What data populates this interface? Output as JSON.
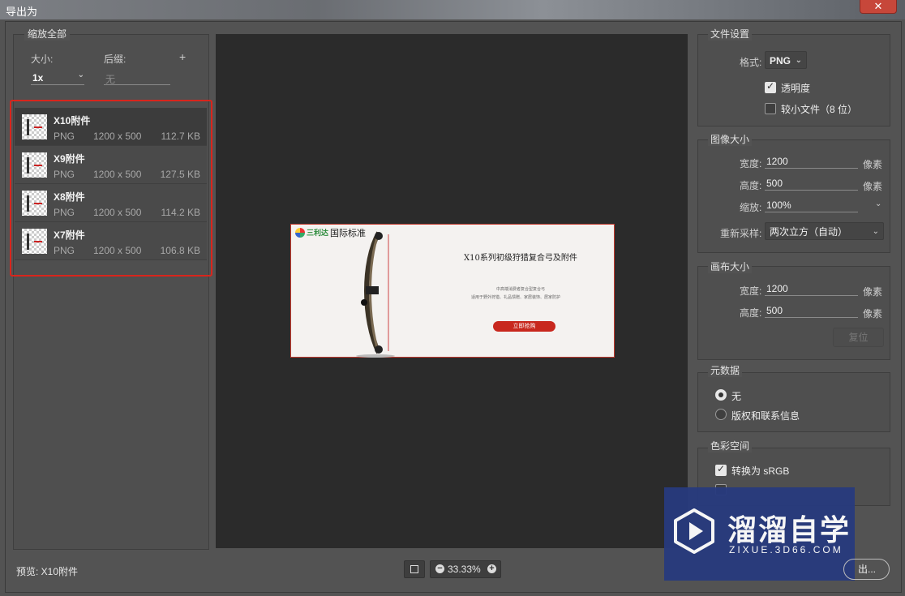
{
  "window": {
    "title": "导出为",
    "close_icon": "✕"
  },
  "left_panel": {
    "group_title": "缩放全部",
    "size_label": "大小:",
    "size_value": "1x",
    "suffix_label": "后缀:",
    "suffix_placeholder": "无",
    "add_icon": "+",
    "assets": [
      {
        "name": "X10附件",
        "format": "PNG",
        "dims": "1200 x 500",
        "size": "112.7 KB",
        "selected": true
      },
      {
        "name": "X9附件",
        "format": "PNG",
        "dims": "1200 x 500",
        "size": "127.5 KB",
        "selected": false
      },
      {
        "name": "X8附件",
        "format": "PNG",
        "dims": "1200 x 500",
        "size": "114.2 KB",
        "selected": false
      },
      {
        "name": "X7附件",
        "format": "PNG",
        "dims": "1200 x 500",
        "size": "106.8 KB",
        "selected": false
      }
    ],
    "highlight_color": "#d9251c"
  },
  "preview": {
    "banner": {
      "logo_text": "国际标准",
      "brand_small": "三利达",
      "headline": "X10系列初级狩猎复合弓及附件",
      "sub1": "中高端消费者复合型复合弓",
      "sub2": "适用于野外狩猎、礼品馈赠、家居装饰、居家防护",
      "cta": "立即抢购",
      "accent": "#c8281e"
    },
    "caption": "预览: X10附件",
    "zoom": "33.33%"
  },
  "file_settings": {
    "title": "文件设置",
    "format_label": "格式:",
    "format_value": "PNG",
    "transparency_label": "透明度",
    "transparency_checked": true,
    "smaller_file_label": "较小文件（8 位）",
    "smaller_file_checked": false
  },
  "image_size": {
    "title": "图像大小",
    "width_label": "宽度:",
    "width_value": "1200",
    "height_label": "高度:",
    "height_value": "500",
    "scale_label": "缩放:",
    "scale_value": "100%",
    "unit": "像素",
    "resample_label": "重新采样:",
    "resample_value": "两次立方（自动）"
  },
  "canvas_size": {
    "title": "画布大小",
    "width_label": "宽度:",
    "width_value": "1200",
    "height_label": "高度:",
    "height_value": "500",
    "unit": "像素",
    "reset_label": "复位"
  },
  "metadata": {
    "title": "元数据",
    "option_none": "无",
    "option_copyright": "版权和联系信息",
    "selected": "无"
  },
  "color_space": {
    "title": "色彩空间",
    "srgb_label": "转换为 sRGB",
    "srgb_checked": true
  },
  "watermark": {
    "title": "溜溜自学",
    "url": "ZIXUE.3D66.COM"
  },
  "footer": {
    "export_label": "出..."
  }
}
